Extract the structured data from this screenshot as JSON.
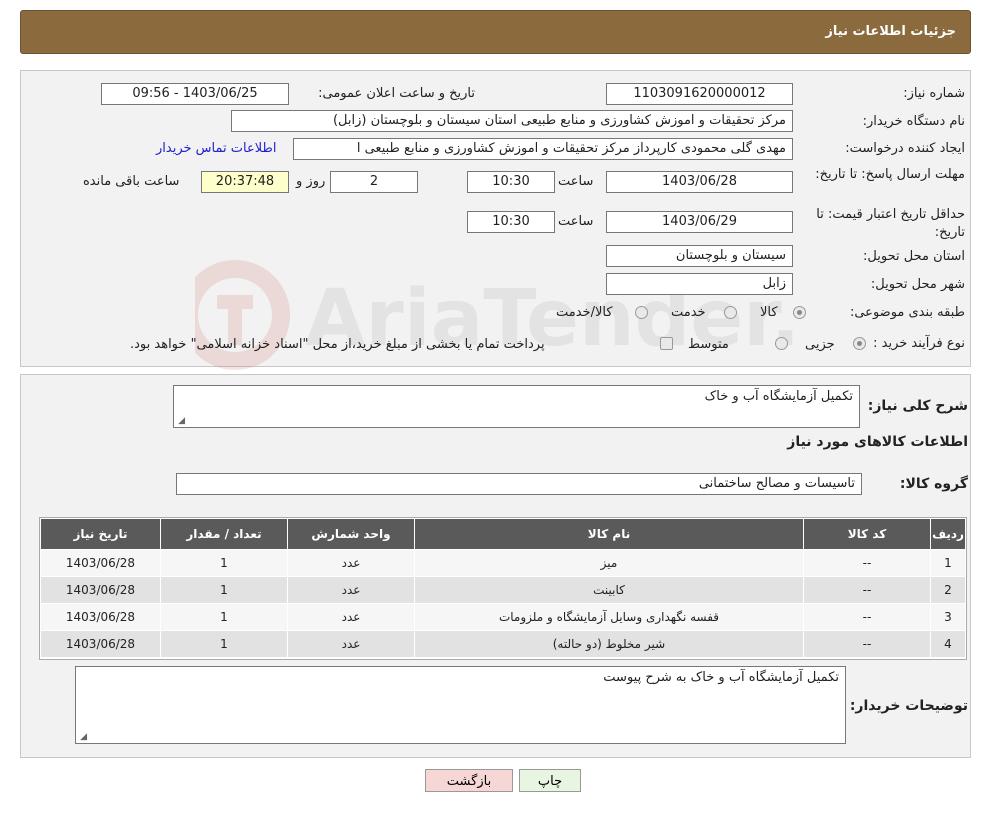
{
  "header": {
    "title": "جزئيات اطلاعات نیاز"
  },
  "watermark": {
    "text": "AriaTender.neT"
  },
  "form": {
    "need_number_label": "شماره نیاز:",
    "need_number": "1103091620000012",
    "announce_label": "تاریخ و ساعت اعلان عمومی:",
    "announce_value": "1403/06/25 - 09:56",
    "buyer_org_label": "نام دستگاه خریدار:",
    "buyer_org": "مرکز تحقیقات و اموزش کشاورزی و منابع طبیعی استان سیستان و بلوچستان (زابل)",
    "creator_label": "ایجاد کننده درخواست:",
    "creator": "مهدی  گلی محمودی کارپرداز مرکز تحقیقات و اموزش کشاورزی و منابع طبیعی ا",
    "contact_link": "اطلاعات تماس خریدار",
    "reply_deadline_label": "مهلت ارسال پاسخ: تا تاریخ:",
    "reply_date": "1403/06/28",
    "time_label": "ساعت",
    "reply_time": "10:30",
    "days_value": "2",
    "days_label": "روز و",
    "remaining_time": "20:37:48",
    "remaining_label": "ساعت باقی مانده",
    "price_validity_label": "حداقل تاریخ اعتبار قیمت: تا تاریخ:",
    "price_date": "1403/06/29",
    "price_time": "10:30",
    "province_label": "استان محل تحویل:",
    "province": "سیستان و بلوچستان",
    "city_label": "شهر محل تحویل:",
    "city": "زابل",
    "category_label": "طبقه بندی موضوعی:",
    "category_options": [
      "کالا",
      "خدمت",
      "کالا/خدمت"
    ],
    "process_label": "نوع فرآیند خرید :",
    "process_options": [
      "جزیی",
      "متوسط"
    ],
    "payment_note": "پرداخت تمام یا بخشی از مبلغ خرید،از محل \"اسناد خزانه اسلامی\" خواهد بود."
  },
  "details": {
    "summary_label": "شرح کلی نیاز:",
    "summary": "تکمیل آزمایشگاه آب و خاک",
    "items_title": "اطلاعات کالاهای مورد نیاز",
    "group_label": "گروه کالا:",
    "group_value": "تاسیسات و مصالح ساختمانی",
    "table_headers": [
      "ردیف",
      "کد کالا",
      "نام کالا",
      "واحد شمارش",
      "تعداد / مقدار",
      "تاریخ نیاز"
    ],
    "rows": [
      {
        "row": "1",
        "code": "--",
        "name": "میز",
        "unit": "عدد",
        "qty": "1",
        "date": "1403/06/28"
      },
      {
        "row": "2",
        "code": "--",
        "name": "کابینت",
        "unit": "عدد",
        "qty": "1",
        "date": "1403/06/28"
      },
      {
        "row": "3",
        "code": "--",
        "name": "قفسه نگهداری وسایل آزمایشگاه و ملزومات",
        "unit": "عدد",
        "qty": "1",
        "date": "1403/06/28"
      },
      {
        "row": "4",
        "code": "--",
        "name": "شیر مخلوط (دو حالته)",
        "unit": "عدد",
        "qty": "1",
        "date": "1403/06/28"
      }
    ],
    "buyer_notes_label": "توضیحات خریدار:",
    "buyer_notes": "تکمیل آزمایشگاه آب و خاک به شرح پیوست"
  },
  "buttons": {
    "print": "چاپ",
    "back": "بازگشت"
  }
}
